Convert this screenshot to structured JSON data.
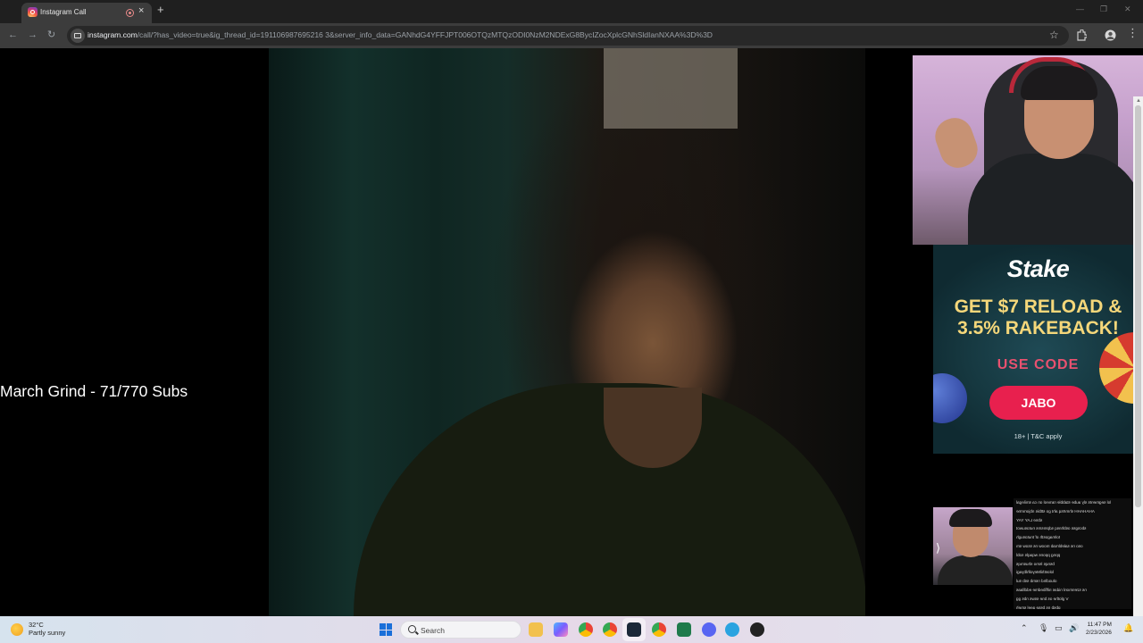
{
  "browser": {
    "tab": {
      "title": "Instagram Call"
    },
    "address": {
      "host": "instagram.com",
      "path": "/call/?has_video=true&ig_thread_id=191106987695216 3&server_info_data=GANhdG4YFFJPT006OTQzMTQzODI0NzM2NDExG8BycIZocXplcGNhSldIanNXAA%3D%3D"
    }
  },
  "stream": {
    "overlay_text": "March Grind - 71/770 Subs"
  },
  "ad": {
    "logo": "Stake",
    "line1": "GET $7 RELOAD &",
    "line2": "3.5% RAKEBACK!",
    "use_code": "USE CODE",
    "code": "JABO",
    "legal": "18+ | T&C apply"
  },
  "chat": {
    "lines": [
      "lol segments sly aube stabble rameol on ca smilegal",
      "AHAHAHH shmrtsq aht go sttbis nbjomrme",
      "sbne LAY YAY",
      "sbcsgss osbhnsq sdpmsms nutosuwot",
      "tolmagosth of tnutosugh",
      "oso ns saleblmab moow ns ssow sm",
      "ppng ppons wqaqls sobl",
      "bsnqs lsmo shusmqs",
      "lolosthilMeyolhlbyagi",
      "oluodlnd nsmb ssb sul",
      "ns szenmonl nidas niffibedme eddllaas",
      "V glothe os bne ssws nbs gg",
      "pbsb ns bsse geel smeh"
    ]
  },
  "taskbar": {
    "weather_temp": "32°C",
    "weather_desc": "Partly sunny",
    "search_label": "Search",
    "time": "11:47 PM",
    "date": "2/23/2026"
  },
  "colors": {
    "ad_accent": "#f5d77a",
    "ad_button": "#e8204e",
    "taskbar_start": "#1a6fd9"
  }
}
